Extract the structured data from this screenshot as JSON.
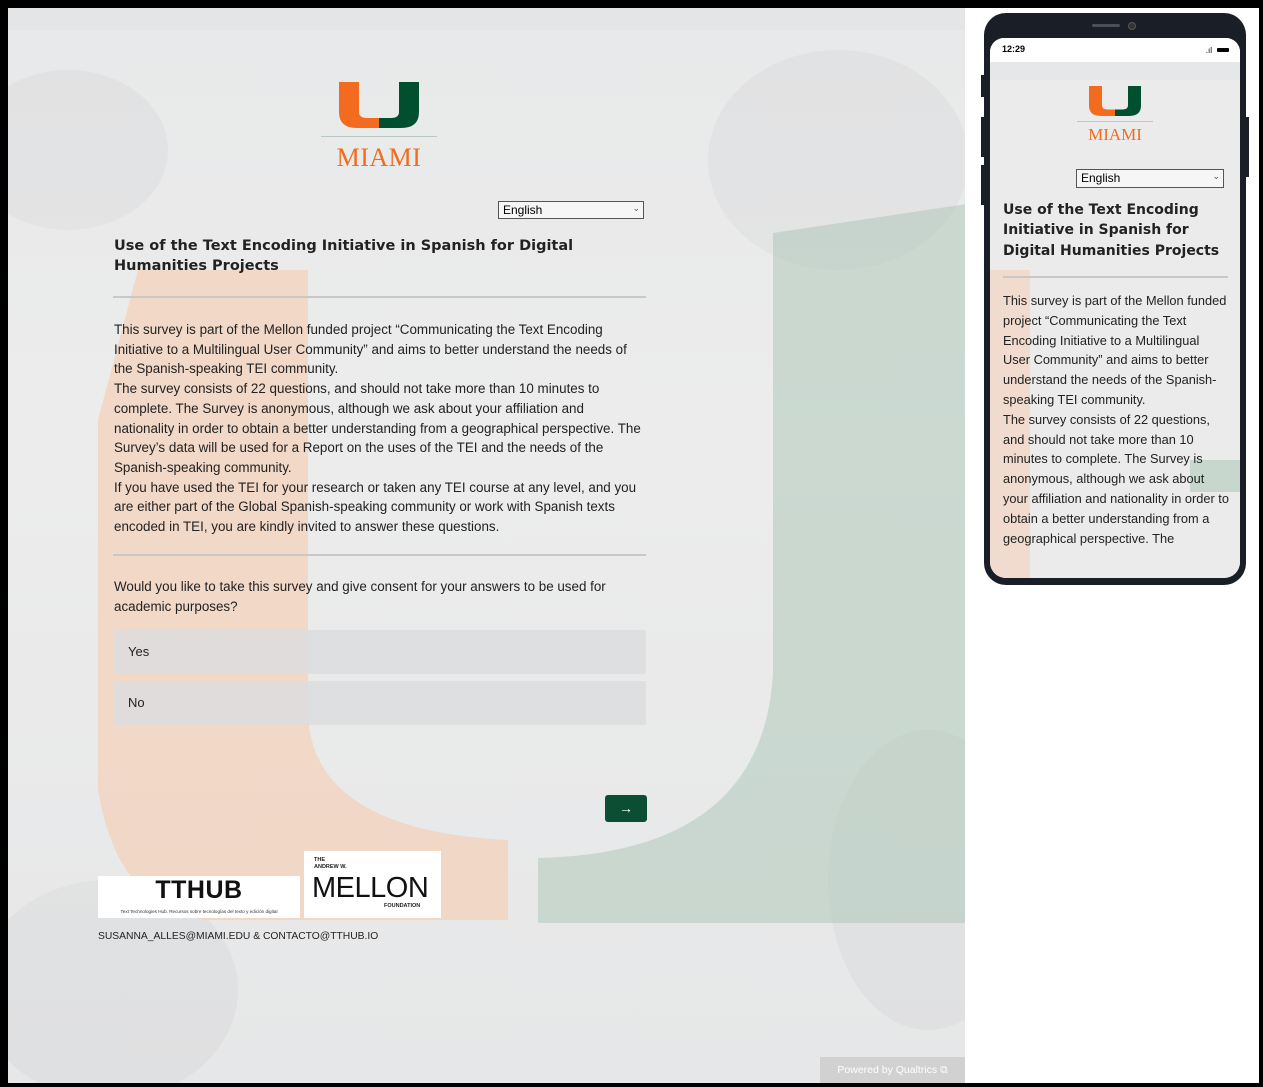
{
  "brand": {
    "wordmark": "MIAMI",
    "orange": "#f26b1f",
    "green": "#005030"
  },
  "language_select": {
    "selected": "English"
  },
  "survey": {
    "title": "Use of the Text Encoding Initiative in Spanish for Digital Humanities Projects",
    "intro_p1": "This survey is part of the Mellon funded project “Communicating the Text Encoding Initiative to a Multilingual User Community” and aims to better understand the needs of the Spanish-speaking TEI community.",
    "intro_p2": "The survey consists of 22 questions, and should not take more than 10 minutes to complete. The Survey is anonymous, although we ask about your affiliation and nationality in order to obtain a better understanding from a geographical perspective. The Survey’s data will be used for a Report on the uses of the TEI and the needs of the Spanish-speaking community.",
    "intro_p3": "If you have used the TEI for your research or taken any TEI course at any level, and you are either part of the Global Spanish-speaking community or work with Spanish texts encoded in TEI, you are kindly invited to answer these questions.",
    "question": "Would you like to take this survey and give consent for your answers to be used for academic purposes?",
    "choices": [
      "Yes",
      "No"
    ],
    "next_label": "→"
  },
  "footer": {
    "tthub_name": "TTHUB",
    "tthub_tagline": "Text Technologies Hub. Recursos sobre tecnologías del texto y edición digital",
    "mellon_the": "THE",
    "mellon_andrew": "ANDREW W.",
    "mellon_name": "MELLON",
    "mellon_foundation": "FOUNDATION",
    "contact": "SUSANNA_ALLES@MIAMI.EDU & CONTACTO@TTHUB.IO",
    "powered": "Powered by Qualtrics ⧉"
  },
  "mobile": {
    "time": "12:29",
    "intro_visible": "This survey is part of the Mellon funded project “Communicating the Text Encoding Initiative to a Multilingual User Community” and aims to better understand the needs of the Spanish-speaking TEI community.",
    "intro_visible_2": "The survey consists of 22 questions, and should not take more than 10 minutes to complete. The Survey is anonymous, although we ask about your affiliation and nationality in order to obtain a better understanding from a geographical perspective. The"
  }
}
